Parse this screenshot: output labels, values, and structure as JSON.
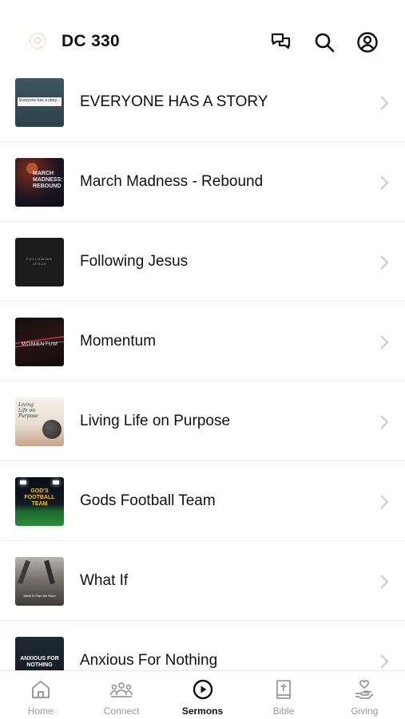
{
  "header": {
    "title": "DC 330",
    "icons": [
      "chat-icon",
      "search-icon",
      "account-icon"
    ]
  },
  "sermons": [
    {
      "title": "EVERYONE HAS A STORY",
      "thumb_text": "Everyone has a story..."
    },
    {
      "title": "March Madness - Rebound",
      "thumb_text": "MARCH MADNESS: REBOUND"
    },
    {
      "title": "Following Jesus",
      "thumb_text": "FOLLOWING JESUS"
    },
    {
      "title": "Momentum",
      "thumb_text": "MOMENTUM"
    },
    {
      "title": "Living Life on Purpose",
      "thumb_text": "Living Life on Purpose"
    },
    {
      "title": "Gods Football Team",
      "thumb_text": "GOD'S FOOTBALL TEAM"
    },
    {
      "title": "What If",
      "thumb_text": "What If I Ran the Race"
    },
    {
      "title": "Anxious For Nothing",
      "thumb_text": "ANXIOUS FOR NOTHING"
    }
  ],
  "tabs": [
    {
      "label": "Home",
      "icon": "home-icon",
      "active": false
    },
    {
      "label": "Connect",
      "icon": "people-icon",
      "active": false
    },
    {
      "label": "Sermons",
      "icon": "play-icon",
      "active": true
    },
    {
      "label": "Bible",
      "icon": "bible-icon",
      "active": false
    },
    {
      "label": "Giving",
      "icon": "giving-icon",
      "active": false
    }
  ],
  "colors": {
    "accent": "#111111",
    "inactive": "#9a9a9a",
    "divider": "#ececec"
  }
}
